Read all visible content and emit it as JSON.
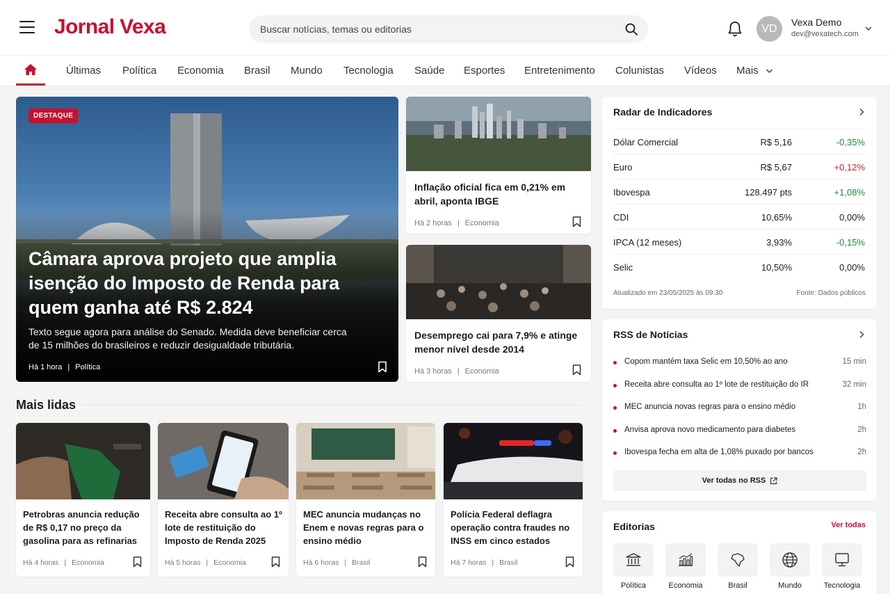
{
  "header": {
    "logo": "Jornal Vexa",
    "search_placeholder": "Buscar notícias, temas ou editorias",
    "user": {
      "initials": "VD",
      "name": "Vexa Demo",
      "email": "dev@vexatech.com"
    }
  },
  "nav": {
    "items": [
      "Últimas",
      "Política",
      "Economia",
      "Brasil",
      "Mundo",
      "Tecnologia",
      "Saúde",
      "Esportes",
      "Entretenimento",
      "Colunistas",
      "Vídeos",
      "Mais"
    ]
  },
  "hero": {
    "badge": "DESTAQUE",
    "title": "Câmara aprova projeto que amplia isenção do Imposto de Renda para quem ganha até R$ 2.824",
    "description": "Texto segue agora para análise do Senado. Medida deve beneficiar cerca de 15 milhões do brasileiros e reduzir desigualdade tributária.",
    "time": "Há 1 hora",
    "category": "Política"
  },
  "side_cards": [
    {
      "title": "Inflação oficial fica em 0,21% em abril, aponta IBGE",
      "time": "Há 2 horas",
      "category": "Economia"
    },
    {
      "title": "Desemprego cai para 7,9% e atinge menor nível desde 2014",
      "time": "Há 3 horas",
      "category": "Economia"
    }
  ],
  "most_read": {
    "title": "Mais lidas",
    "items": [
      {
        "title": "Petrobras anuncia redução de R$ 0,17 no preço da gasolina para as refinarias",
        "time": "Há 4 horas",
        "category": "Economia"
      },
      {
        "title": "Receita abre consulta ao 1º lote de restituição do Imposto de Renda 2025",
        "time": "Há 5 horas",
        "category": "Economia"
      },
      {
        "title": "MEC anuncia mudanças no Enem e novas regras para o ensino médio",
        "time": "Há 6 horas",
        "category": "Brasil"
      },
      {
        "title": "Polícia Federal deflagra operação contra fraudes no INSS em cinco estados",
        "time": "Há 7 horas",
        "category": "Brasil"
      }
    ]
  },
  "indicators": {
    "title": "Radar de Indicadores",
    "rows": [
      {
        "name": "Dólar Comercial",
        "value": "R$ 5,16",
        "change": "-0,35%",
        "tone": "up"
      },
      {
        "name": "Euro",
        "value": "R$ 5,67",
        "change": "+0,12%",
        "tone": "red"
      },
      {
        "name": "Ibovespa",
        "value": "128.497 pts",
        "change": "+1,08%",
        "tone": "up"
      },
      {
        "name": "CDI",
        "value": "10,65%",
        "change": "0,00%",
        "tone": "neutral"
      },
      {
        "name": "IPCA (12 meses)",
        "value": "3,93%",
        "change": "-0,15%",
        "tone": "up"
      },
      {
        "name": "Selic",
        "value": "10,50%",
        "change": "0,00%",
        "tone": "neutral"
      }
    ],
    "updated": "Atualizado em 23/05/2025 às 09:30",
    "source": "Fonte: Dados públicos"
  },
  "rss": {
    "title": "RSS de Notícias",
    "items": [
      {
        "text": "Copom mantém taxa Selic em 10,50% ao ano",
        "time": "15 min"
      },
      {
        "text": "Receita abre consulta ao 1º lote de restituição do IR",
        "time": "32 min"
      },
      {
        "text": "MEC anuncia novas regras para o ensino médio",
        "time": "1h"
      },
      {
        "text": "Anvisa aprova novo medicamento para diabetes",
        "time": "2h"
      },
      {
        "text": "Ibovespa fecha em alta de 1,08% puxado por bancos",
        "time": "2h"
      }
    ],
    "button": "Ver todas no RSS"
  },
  "editorias": {
    "title": "Editorias",
    "link": "Ver todas",
    "items": [
      {
        "label": "Política",
        "icon": "bank-icon"
      },
      {
        "label": "Economia",
        "icon": "chart-icon"
      },
      {
        "label": "Brasil",
        "icon": "brazil-map-icon"
      },
      {
        "label": "Mundo",
        "icon": "globe-icon"
      },
      {
        "label": "Tecnologia",
        "icon": "monitor-icon"
      }
    ]
  },
  "colors": {
    "brand": "#c8102e",
    "positive": "#1e8a3e",
    "negative": "#d21f2e"
  }
}
